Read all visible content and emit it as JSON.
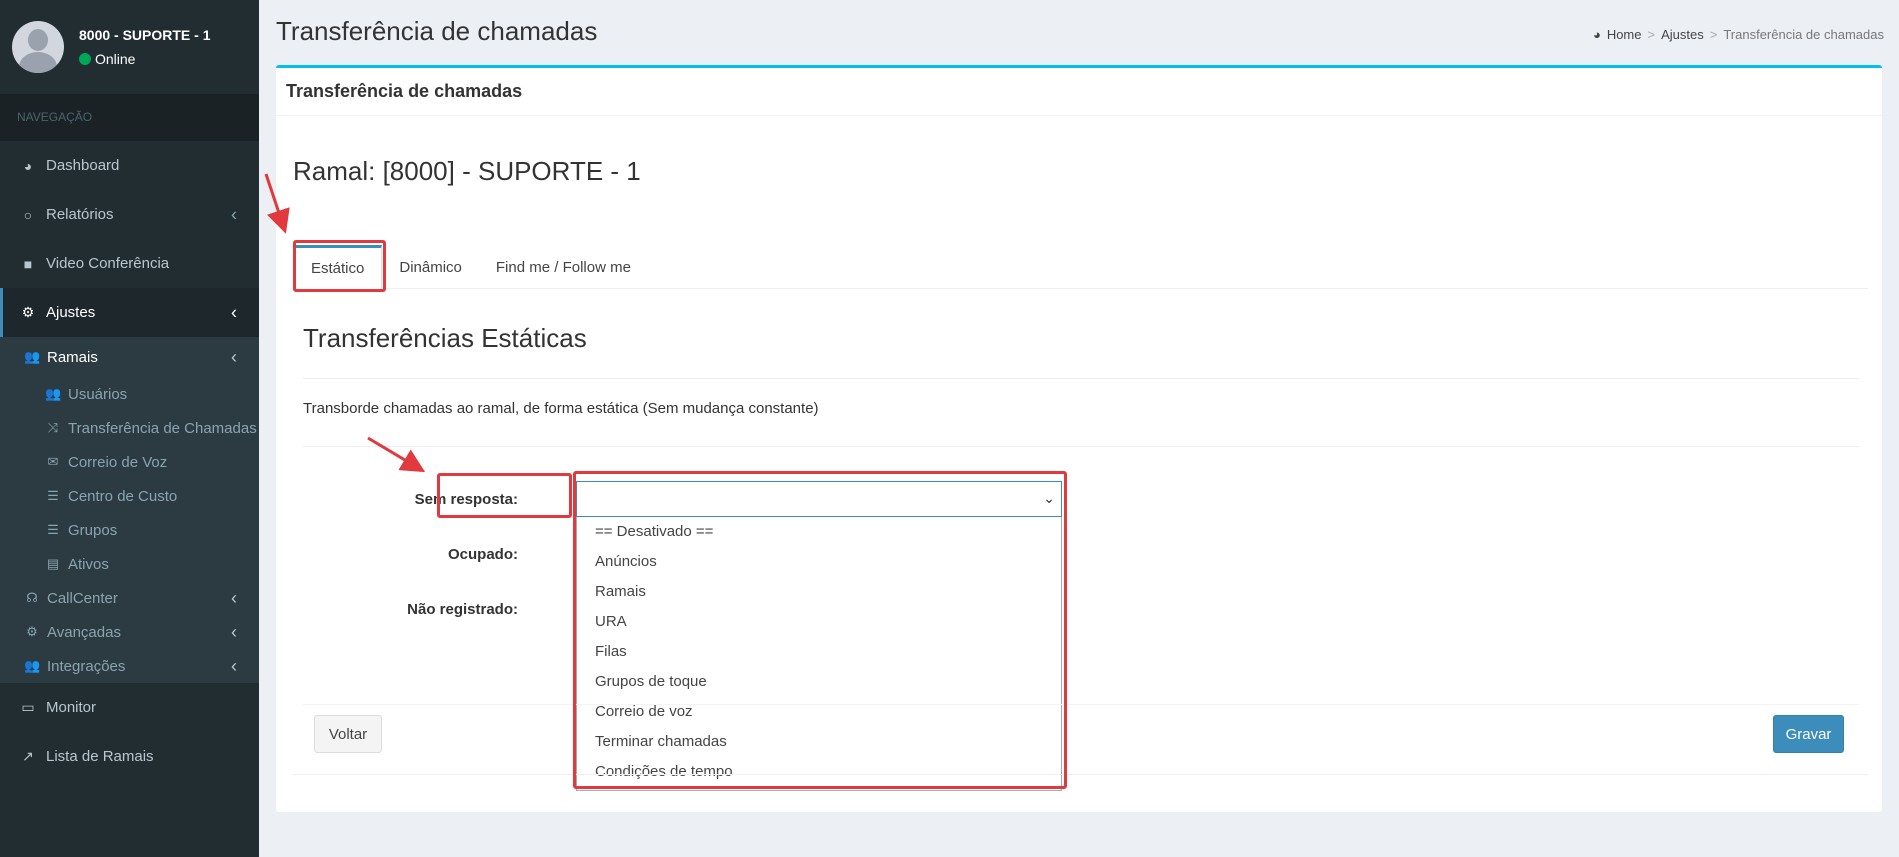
{
  "user": {
    "name": "8000 - SUPORTE - 1",
    "status": "Online"
  },
  "sidebar": {
    "header": "NAVEGAÇÃO",
    "items": {
      "dashboard": "Dashboard",
      "relatorios": "Relatórios",
      "video": "Video Conferência",
      "ajustes": "Ajustes",
      "ramais": "Ramais",
      "usuarios": "Usuários",
      "transferencia": "Transferência de Chamadas",
      "correio": "Correio de Voz",
      "centro": "Centro de Custo",
      "grupos": "Grupos",
      "ativos": "Ativos",
      "callcenter": "CallCenter",
      "avancadas": "Avançadas",
      "integracoes": "Integrações",
      "monitor": "Monitor",
      "lista": "Lista de Ramais"
    }
  },
  "page": {
    "title": "Transferência de chamadas",
    "breadcrumb": {
      "home": "Home",
      "ajustes": "Ajustes",
      "current": "Transferência de chamadas"
    },
    "box_title": "Transferência de chamadas",
    "ramal_title": "Ramal: [8000] - SUPORTE - 1"
  },
  "tabs": {
    "estatico": "Estático",
    "dinamico": "Dinâmico",
    "findme": "Find me / Follow me"
  },
  "section": {
    "title": "Transferências Estáticas",
    "description": "Transborde chamadas ao ramal, de forma estática (Sem mudança constante)"
  },
  "form": {
    "sem_resposta": "Sem resposta:",
    "ocupado": "Ocupado:",
    "nao_registrado": "Não registrado:",
    "options": [
      "== Desativado ==",
      "Anúncios",
      "Ramais",
      "URA",
      "Filas",
      "Grupos de toque",
      "Correio de voz",
      "Terminar chamadas",
      "Condições de tempo"
    ]
  },
  "buttons": {
    "voltar": "Voltar",
    "gravar": "Gravar"
  },
  "colors": {
    "sidebar": "#222d32",
    "accent": "#3c8dbc",
    "highlight": "#e0393e",
    "box_top": "#00c0ef"
  }
}
